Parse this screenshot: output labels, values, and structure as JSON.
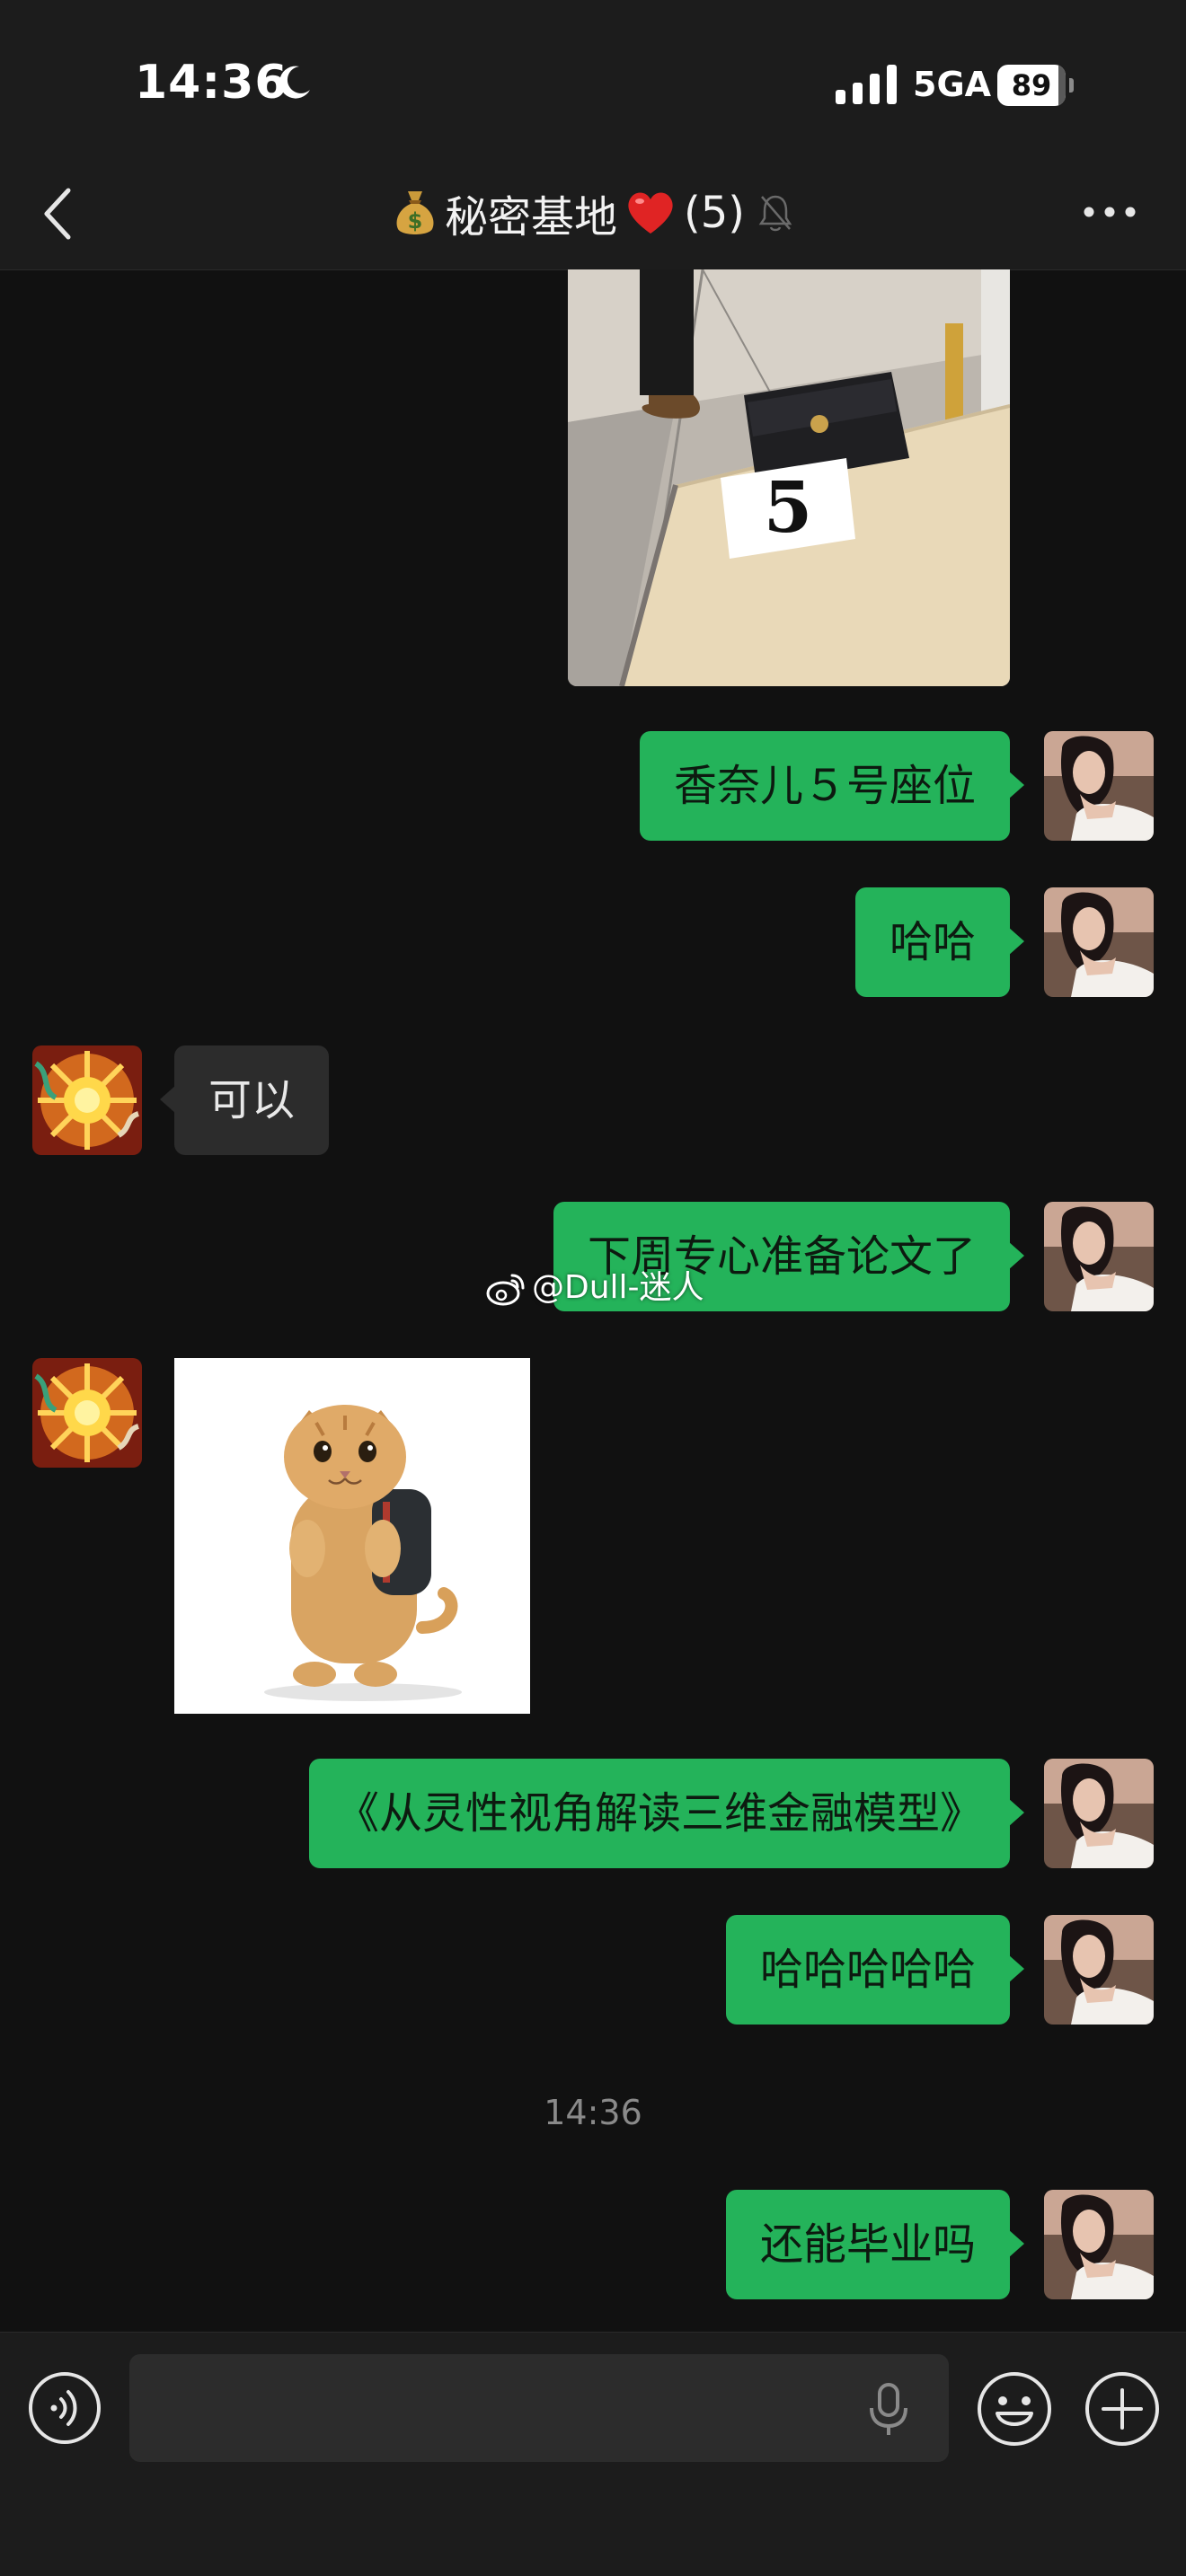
{
  "status_bar": {
    "time": "14:36",
    "network": "5GA",
    "battery_percent": "89",
    "battery_level": 0.89
  },
  "header": {
    "title": "秘密基地",
    "member_count": "(5)",
    "icons": [
      "back-icon",
      "money-bag-icon",
      "heart-icon",
      "mute-bell-icon",
      "more-icon"
    ]
  },
  "messages": [
    {
      "direction": "sent",
      "type": "image",
      "icon": "photo-chanel-wallet-seat-5",
      "image_text": "5"
    },
    {
      "direction": "sent",
      "type": "text",
      "text": "香奈儿５号座位"
    },
    {
      "direction": "sent",
      "type": "text",
      "text": "哈哈"
    },
    {
      "direction": "received",
      "type": "text",
      "text": "可以"
    },
    {
      "direction": "sent",
      "type": "text",
      "text": "下周专心准备论文了"
    },
    {
      "direction": "received",
      "type": "sticker",
      "icon": "cat-with-backpack-sticker"
    },
    {
      "direction": "sent",
      "type": "text",
      "text": "《从灵性视角解读三维金融模型》"
    },
    {
      "direction": "sent",
      "type": "text",
      "text": "哈哈哈哈哈"
    },
    {
      "direction": "system",
      "type": "timestamp",
      "text": "14:36"
    },
    {
      "direction": "sent",
      "type": "text",
      "text": "还能毕业吗"
    }
  ],
  "watermark": {
    "text": "@Dull-迷人",
    "icon": "weibo-icon"
  },
  "input_bar": {
    "icons": [
      "voice-icon",
      "mic-icon",
      "emoji-icon",
      "plus-icon"
    ]
  },
  "colors": {
    "background": "#111111",
    "bar_background": "#1c1c1c",
    "sent_bubble": "#24b35a",
    "received_bubble": "#2c2c2c",
    "heart": "#e02424"
  }
}
